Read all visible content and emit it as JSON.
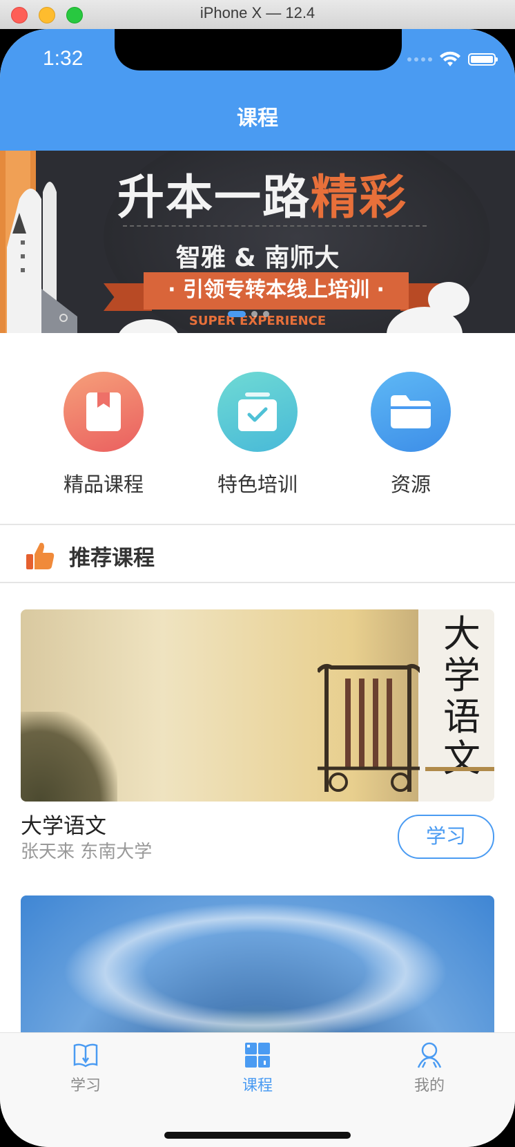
{
  "window": {
    "title": "iPhone X — 12.4"
  },
  "status_bar": {
    "time": "1:32"
  },
  "header": {
    "title": "课程"
  },
  "banner": {
    "title_part1": "升本一路",
    "title_part2": "精彩",
    "subtitle": "智雅 & 南师大",
    "ribbon": "· 引领专转本线上培训 ·",
    "tagline": "SUPER EXPERIENCE",
    "page_count": 3,
    "active_page": 1
  },
  "features": [
    {
      "label": "精品课程",
      "icon": "bookmark-book-icon"
    },
    {
      "label": "特色培训",
      "icon": "checked-box-icon"
    },
    {
      "label": "资源",
      "icon": "folder-icon"
    }
  ],
  "recommend": {
    "title": "推荐课程",
    "icon": "thumbs-up-icon"
  },
  "courses": [
    {
      "name": "大学语文",
      "meta": "张天来  东南大学",
      "button": "学习",
      "cover_text": "大学语文"
    }
  ],
  "tabbar": {
    "items": [
      {
        "label": "学习",
        "icon": "book-icon",
        "active": false
      },
      {
        "label": "课程",
        "icon": "grid-icon",
        "active": true
      },
      {
        "label": "我的",
        "icon": "person-icon",
        "active": false
      }
    ]
  },
  "colors": {
    "accent": "#4a9bf2",
    "banner_orange": "#e8703a",
    "feature1": "#ef7b6a",
    "feature2": "#5ccbd6",
    "feature3": "#4a9bf2"
  }
}
